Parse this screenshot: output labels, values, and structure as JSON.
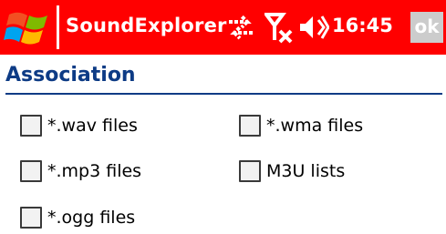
{
  "titlebar": {
    "app_title": "SoundExplorer",
    "clock": "16:45",
    "ok_label": "ok",
    "icons": [
      "windows-start-icon",
      "connectivity-arrows-icon",
      "signal-off-icon",
      "speaker-icon"
    ],
    "background_color": "#ff0000"
  },
  "section": {
    "title": "Association",
    "title_color": "#0d3b85"
  },
  "options": [
    {
      "label": "*.wav files",
      "checked": false
    },
    {
      "label": "*.wma files",
      "checked": false
    },
    {
      "label": "*.mp3 files",
      "checked": false
    },
    {
      "label": "M3U lists",
      "checked": false
    },
    {
      "label": "*.ogg files",
      "checked": false
    }
  ]
}
